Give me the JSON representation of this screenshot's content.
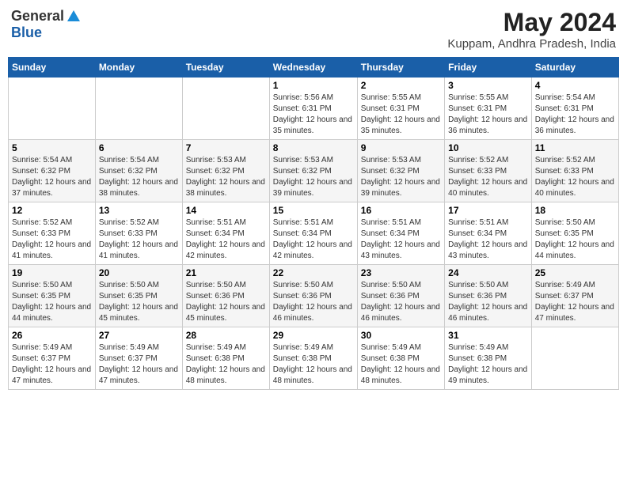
{
  "logo": {
    "general": "General",
    "blue": "Blue"
  },
  "title": {
    "month_year": "May 2024",
    "location": "Kuppam, Andhra Pradesh, India"
  },
  "days_of_week": [
    "Sunday",
    "Monday",
    "Tuesday",
    "Wednesday",
    "Thursday",
    "Friday",
    "Saturday"
  ],
  "weeks": [
    {
      "days": [
        {
          "num": "",
          "info": ""
        },
        {
          "num": "",
          "info": ""
        },
        {
          "num": "",
          "info": ""
        },
        {
          "num": "1",
          "info": "Sunrise: 5:56 AM\nSunset: 6:31 PM\nDaylight: 12 hours and 35 minutes."
        },
        {
          "num": "2",
          "info": "Sunrise: 5:55 AM\nSunset: 6:31 PM\nDaylight: 12 hours and 35 minutes."
        },
        {
          "num": "3",
          "info": "Sunrise: 5:55 AM\nSunset: 6:31 PM\nDaylight: 12 hours and 36 minutes."
        },
        {
          "num": "4",
          "info": "Sunrise: 5:54 AM\nSunset: 6:31 PM\nDaylight: 12 hours and 36 minutes."
        }
      ]
    },
    {
      "days": [
        {
          "num": "5",
          "info": "Sunrise: 5:54 AM\nSunset: 6:32 PM\nDaylight: 12 hours and 37 minutes."
        },
        {
          "num": "6",
          "info": "Sunrise: 5:54 AM\nSunset: 6:32 PM\nDaylight: 12 hours and 38 minutes."
        },
        {
          "num": "7",
          "info": "Sunrise: 5:53 AM\nSunset: 6:32 PM\nDaylight: 12 hours and 38 minutes."
        },
        {
          "num": "8",
          "info": "Sunrise: 5:53 AM\nSunset: 6:32 PM\nDaylight: 12 hours and 39 minutes."
        },
        {
          "num": "9",
          "info": "Sunrise: 5:53 AM\nSunset: 6:32 PM\nDaylight: 12 hours and 39 minutes."
        },
        {
          "num": "10",
          "info": "Sunrise: 5:52 AM\nSunset: 6:33 PM\nDaylight: 12 hours and 40 minutes."
        },
        {
          "num": "11",
          "info": "Sunrise: 5:52 AM\nSunset: 6:33 PM\nDaylight: 12 hours and 40 minutes."
        }
      ]
    },
    {
      "days": [
        {
          "num": "12",
          "info": "Sunrise: 5:52 AM\nSunset: 6:33 PM\nDaylight: 12 hours and 41 minutes."
        },
        {
          "num": "13",
          "info": "Sunrise: 5:52 AM\nSunset: 6:33 PM\nDaylight: 12 hours and 41 minutes."
        },
        {
          "num": "14",
          "info": "Sunrise: 5:51 AM\nSunset: 6:34 PM\nDaylight: 12 hours and 42 minutes."
        },
        {
          "num": "15",
          "info": "Sunrise: 5:51 AM\nSunset: 6:34 PM\nDaylight: 12 hours and 42 minutes."
        },
        {
          "num": "16",
          "info": "Sunrise: 5:51 AM\nSunset: 6:34 PM\nDaylight: 12 hours and 43 minutes."
        },
        {
          "num": "17",
          "info": "Sunrise: 5:51 AM\nSunset: 6:34 PM\nDaylight: 12 hours and 43 minutes."
        },
        {
          "num": "18",
          "info": "Sunrise: 5:50 AM\nSunset: 6:35 PM\nDaylight: 12 hours and 44 minutes."
        }
      ]
    },
    {
      "days": [
        {
          "num": "19",
          "info": "Sunrise: 5:50 AM\nSunset: 6:35 PM\nDaylight: 12 hours and 44 minutes."
        },
        {
          "num": "20",
          "info": "Sunrise: 5:50 AM\nSunset: 6:35 PM\nDaylight: 12 hours and 45 minutes."
        },
        {
          "num": "21",
          "info": "Sunrise: 5:50 AM\nSunset: 6:36 PM\nDaylight: 12 hours and 45 minutes."
        },
        {
          "num": "22",
          "info": "Sunrise: 5:50 AM\nSunset: 6:36 PM\nDaylight: 12 hours and 46 minutes."
        },
        {
          "num": "23",
          "info": "Sunrise: 5:50 AM\nSunset: 6:36 PM\nDaylight: 12 hours and 46 minutes."
        },
        {
          "num": "24",
          "info": "Sunrise: 5:50 AM\nSunset: 6:36 PM\nDaylight: 12 hours and 46 minutes."
        },
        {
          "num": "25",
          "info": "Sunrise: 5:49 AM\nSunset: 6:37 PM\nDaylight: 12 hours and 47 minutes."
        }
      ]
    },
    {
      "days": [
        {
          "num": "26",
          "info": "Sunrise: 5:49 AM\nSunset: 6:37 PM\nDaylight: 12 hours and 47 minutes."
        },
        {
          "num": "27",
          "info": "Sunrise: 5:49 AM\nSunset: 6:37 PM\nDaylight: 12 hours and 47 minutes."
        },
        {
          "num": "28",
          "info": "Sunrise: 5:49 AM\nSunset: 6:38 PM\nDaylight: 12 hours and 48 minutes."
        },
        {
          "num": "29",
          "info": "Sunrise: 5:49 AM\nSunset: 6:38 PM\nDaylight: 12 hours and 48 minutes."
        },
        {
          "num": "30",
          "info": "Sunrise: 5:49 AM\nSunset: 6:38 PM\nDaylight: 12 hours and 48 minutes."
        },
        {
          "num": "31",
          "info": "Sunrise: 5:49 AM\nSunset: 6:38 PM\nDaylight: 12 hours and 49 minutes."
        },
        {
          "num": "",
          "info": ""
        }
      ]
    }
  ]
}
